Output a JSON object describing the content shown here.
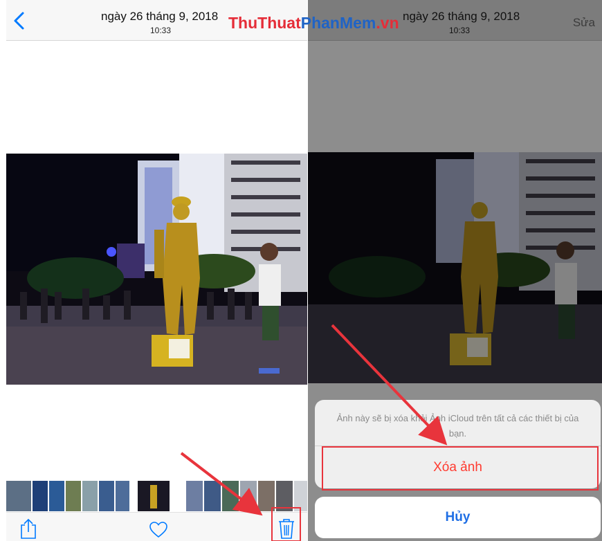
{
  "left_screen": {
    "title": "ngày 26 tháng 9, 2018",
    "time": "10:33"
  },
  "right_screen": {
    "title": "ngày 26 tháng 9, 2018",
    "time": "10:33",
    "edit_label": "Sửa",
    "action_sheet": {
      "message": "Ảnh này sẽ bị xóa khỏi Ảnh iCloud trên tất cả các thiết bị của bạn.",
      "delete_label": "Xóa ảnh",
      "cancel_label": "Hủy"
    }
  },
  "watermark": {
    "part1": "ThuThuat",
    "part2": "PhanMem",
    "part3": ".vn"
  },
  "colors": {
    "ios_blue": "#007aff",
    "destructive_red": "#ff3b30",
    "annotation_red": "#e8343c",
    "watermark_red": "#e52d38",
    "watermark_blue": "#1f63c6"
  },
  "icons": [
    "back-chevron-icon",
    "share-icon",
    "heart-icon",
    "trash-icon"
  ]
}
